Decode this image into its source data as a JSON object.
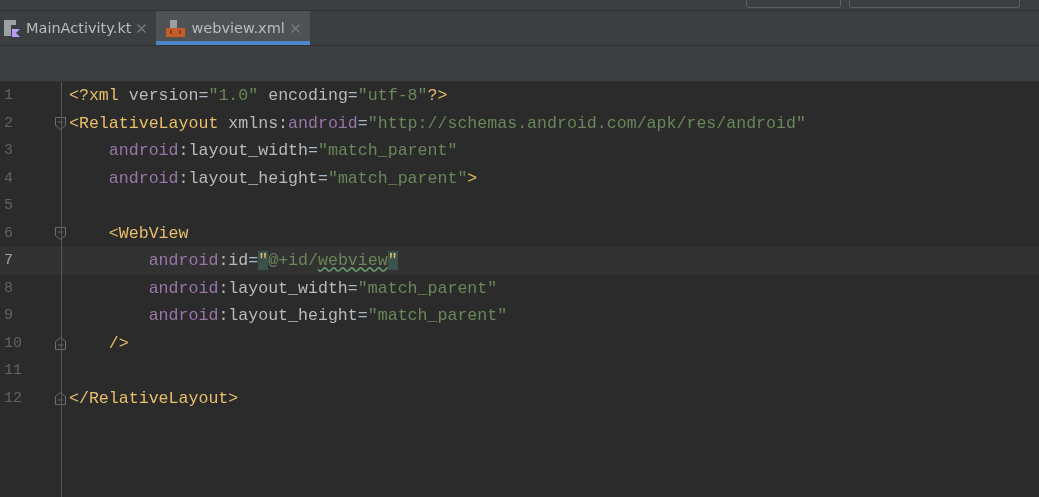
{
  "tabs": [
    {
      "label": "MainActivity.kt",
      "kind": "kotlin",
      "selected": false
    },
    {
      "label": "webview.xml",
      "kind": "xml",
      "selected": true
    }
  ],
  "editor": {
    "lines": [
      {
        "number": "1",
        "current": false,
        "fold_start": false,
        "fold_end": false,
        "tokens": [
          {
            "kind": "tag",
            "text": "<?xml "
          },
          {
            "kind": "attr",
            "text": "version"
          },
          {
            "kind": "plain",
            "text": "="
          },
          {
            "kind": "value",
            "text": "\"1.0\""
          },
          {
            "kind": "attr",
            "text": " encoding"
          },
          {
            "kind": "plain",
            "text": "="
          },
          {
            "kind": "value",
            "text": "\"utf-8\""
          },
          {
            "kind": "tag",
            "text": "?>"
          }
        ]
      },
      {
        "number": "2",
        "current": false,
        "fold_start": true,
        "fold_end": false,
        "tokens": [
          {
            "kind": "tag",
            "text": "<RelativeLayout "
          },
          {
            "kind": "attr",
            "text": "xmlns:"
          },
          {
            "kind": "ns",
            "text": "android"
          },
          {
            "kind": "plain",
            "text": "="
          },
          {
            "kind": "value",
            "text": "\"http://schemas.android.com/apk/res/android\""
          }
        ]
      },
      {
        "number": "3",
        "current": false,
        "fold_start": false,
        "fold_end": false,
        "tokens": [
          {
            "kind": "ns",
            "text": "    android"
          },
          {
            "kind": "attr",
            "text": ":layout_width"
          },
          {
            "kind": "plain",
            "text": "="
          },
          {
            "kind": "value",
            "text": "\"match_parent\""
          }
        ]
      },
      {
        "number": "4",
        "current": false,
        "fold_start": false,
        "fold_end": false,
        "tokens": [
          {
            "kind": "ns",
            "text": "    android"
          },
          {
            "kind": "attr",
            "text": ":layout_height"
          },
          {
            "kind": "plain",
            "text": "="
          },
          {
            "kind": "value",
            "text": "\"match_parent\""
          },
          {
            "kind": "tag",
            "text": ">"
          }
        ]
      },
      {
        "number": "5",
        "current": false,
        "fold_start": false,
        "fold_end": false
      },
      {
        "number": "6",
        "current": false,
        "fold_start": true,
        "fold_end": false,
        "tokens": [
          {
            "kind": "tag",
            "text": "    <WebView"
          }
        ]
      },
      {
        "number": "7",
        "current": true,
        "fold_start": false,
        "fold_end": false,
        "tokens": [
          {
            "kind": "ns",
            "text": "        android"
          },
          {
            "kind": "attr",
            "text": ":id"
          },
          {
            "kind": "plain",
            "text": "="
          },
          {
            "kind": "match",
            "text": "\""
          },
          {
            "kind": "value",
            "text": "@+id/"
          },
          {
            "kind": "typo",
            "text": "webview"
          },
          {
            "kind": "match",
            "text": "\""
          }
        ]
      },
      {
        "number": "8",
        "current": false,
        "fold_start": false,
        "fold_end": false,
        "tokens": [
          {
            "kind": "ns",
            "text": "        android"
          },
          {
            "kind": "attr",
            "text": ":layout_width"
          },
          {
            "kind": "plain",
            "text": "="
          },
          {
            "kind": "value",
            "text": "\"match_parent\""
          }
        ]
      },
      {
        "number": "9",
        "current": false,
        "fold_start": false,
        "fold_end": false,
        "tokens": [
          {
            "kind": "ns",
            "text": "        android"
          },
          {
            "kind": "attr",
            "text": ":layout_height"
          },
          {
            "kind": "plain",
            "text": "="
          },
          {
            "kind": "value",
            "text": "\"match_parent\""
          }
        ]
      },
      {
        "number": "10",
        "current": false,
        "fold_start": false,
        "fold_end": true,
        "tokens": [
          {
            "kind": "tag",
            "text": "    />"
          }
        ]
      },
      {
        "number": "11",
        "current": false,
        "fold_start": false,
        "fold_end": false
      },
      {
        "number": "12",
        "current": false,
        "fold_start": false,
        "fold_end": true,
        "tokens": [
          {
            "kind": "tag",
            "text": "</RelativeLayout>"
          }
        ]
      }
    ]
  }
}
